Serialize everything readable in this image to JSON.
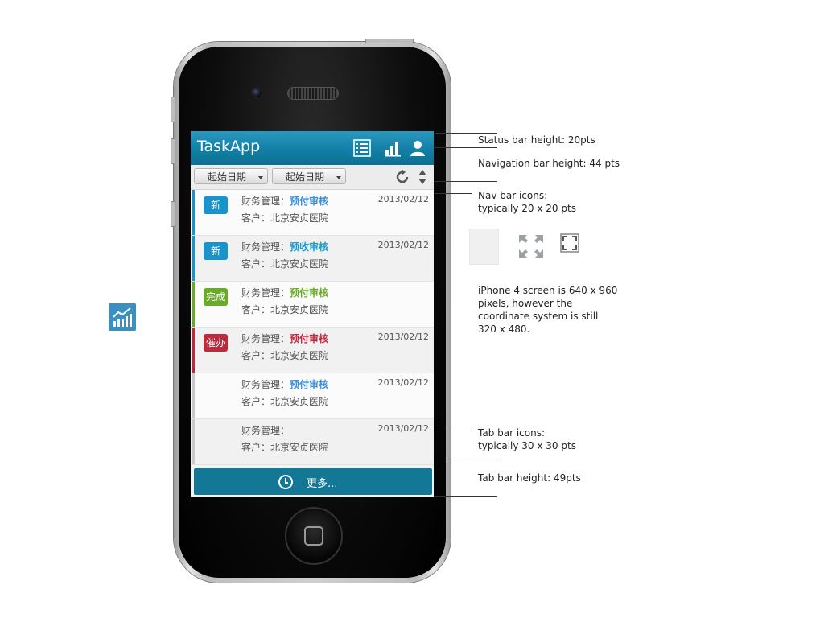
{
  "app": {
    "title": "TaskApp",
    "nav_icons": [
      "list-icon",
      "bar-chart-icon",
      "user-icon"
    ],
    "brand_color": "#137fa6"
  },
  "filter": {
    "date_from_label": "起始日期",
    "date_to_label": "起始日期",
    "refresh_icon": "refresh-icon",
    "sort_icon": "sort-arrows-icon"
  },
  "tasks": [
    {
      "badge": "新",
      "badge_color": "#1993c9",
      "bar_color": "#1993c9",
      "category": "财务管理：",
      "status": "预付审核",
      "status_color": "#3b8fd6",
      "client": "客户：北京安贞医院",
      "date": "2013/02/12"
    },
    {
      "badge": "新",
      "badge_color": "#1993c9",
      "bar_color": "#1993c9",
      "category": "财务管理：",
      "status": "预收审核",
      "status_color": "#1a9bc8",
      "client": "客户：北京安贞医院",
      "date": "2013/02/12"
    },
    {
      "badge": "完成",
      "badge_color": "#6aaa2a",
      "bar_color": "#6aaa2a",
      "category": "财务管理：",
      "status": "预付审核",
      "status_color": "#6aaa2a",
      "client": "客户：北京安贞医院",
      "date": ""
    },
    {
      "badge": "催办",
      "badge_color": "#c0283b",
      "bar_color": "#c0283b",
      "category": "财务管理：",
      "status": "预付审核",
      "status_color": "#c0283b",
      "client": "客户：北京安贞医院",
      "date": "2013/02/12"
    },
    {
      "badge": "",
      "badge_color": "",
      "bar_color": "#c9c9c9",
      "category": "财务管理：",
      "status": "预付审核",
      "status_color": "#3b8fd6",
      "client": "客户：北京安贞医院",
      "date": "2013/02/12"
    },
    {
      "badge": "",
      "badge_color": "",
      "bar_color": "#c9c9c9",
      "category": "财务管理：",
      "status": "",
      "status_color": "#3b8fd6",
      "client": "客户：北京安贞医院",
      "date": "2013/02/12"
    }
  ],
  "more_button": {
    "label": "更多...",
    "icon": "clock-icon"
  },
  "annotations": {
    "status_bar": "Status bar height: 20pts",
    "nav_bar": "Navigation bar height: 44 pts",
    "nav_icons_1": "Nav bar icons:",
    "nav_icons_2": "typically 20 x 20 pts",
    "screen_1": "iPhone 4 screen is 640 x 960",
    "screen_2": "pixels, however the",
    "screen_3": "coordinate system is still",
    "screen_4": "320 x 480.",
    "tab_icons_1": "Tab bar icons:",
    "tab_icons_2": "typically 30 x 30 pts",
    "tab_bar": "Tab bar height: 49pts"
  },
  "sample_icons": [
    "expand-arrows-icon",
    "fullscreen-icon"
  ],
  "side_app_icon": "trend-chart-icon"
}
